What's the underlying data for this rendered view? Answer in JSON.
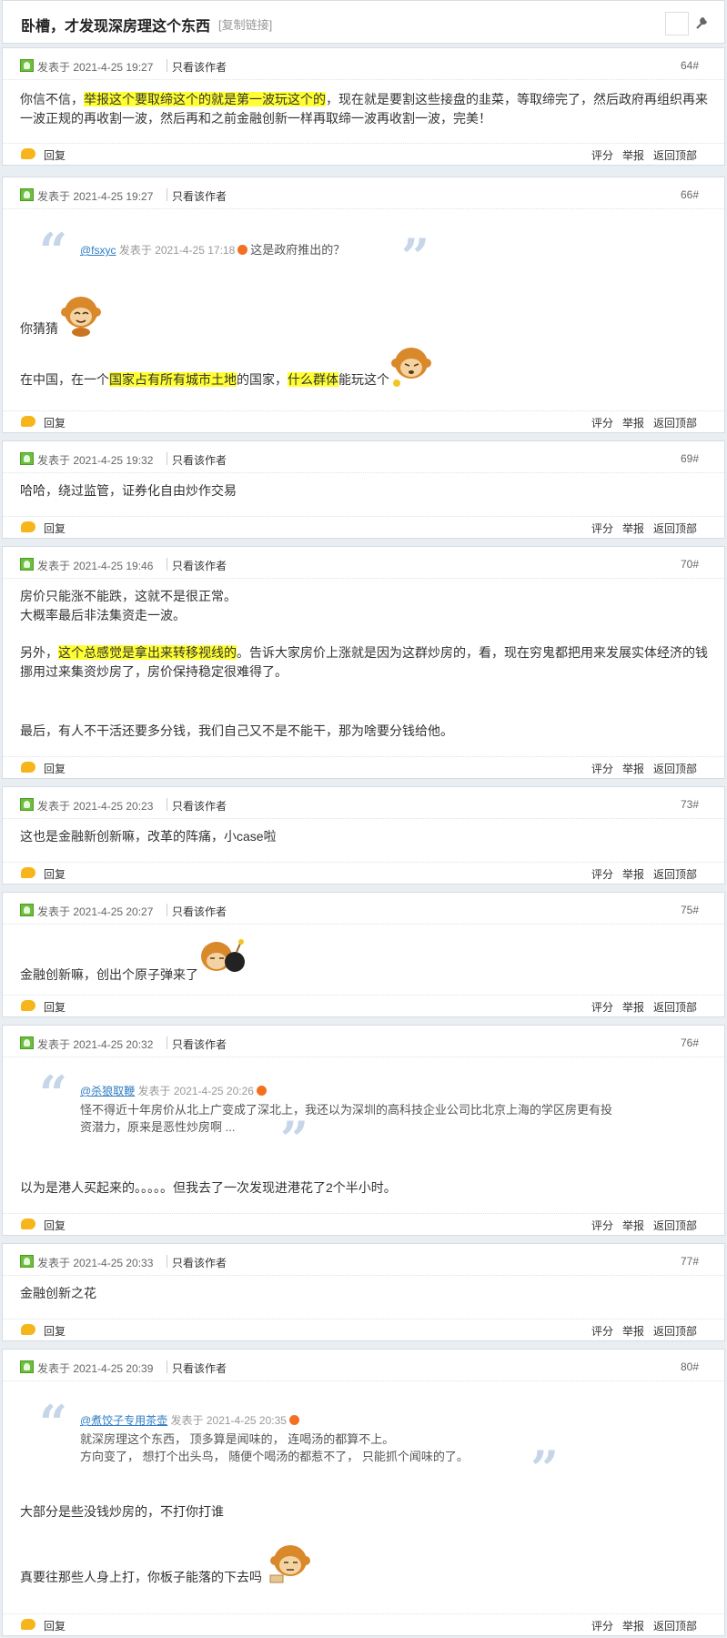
{
  "header": {
    "title": "卧槽，才发现深房理这个东西",
    "copy_link": "[复制链接]"
  },
  "labels": {
    "reply": "回复",
    "rate": "评分",
    "report": "举报",
    "top": "返回顶部",
    "only_author": "只看该作者"
  },
  "posts": [
    {
      "time": "发表于 2021-4-25 19:27",
      "floor": "64#",
      "body": {
        "a": "你信不信，",
        "hl1": "举报这个要取缔这个的就是第一波玩这个的",
        "b": "，现在就是要割这些接盘的韭菜，等取缔完了，然后政府再组织再来",
        "c": "一波正规的再收割一波，然后再和之前金融创新一样再取缔一波再收割一波，完美！"
      }
    },
    {
      "time": "发表于 2021-4-25 19:27",
      "floor": "66#",
      "quote": {
        "author": "@fsxyc",
        "time": "发表于 2021-4-25 17:18",
        "text": "这是政府推出的？"
      },
      "body": {
        "a": "你猜猜",
        "b": "在中国，在一个",
        "hl1": "国家占有所有城市土地",
        "c": "的国家，",
        "hl2": "什么群体",
        "d": "能玩这个"
      }
    },
    {
      "time": "发表于 2021-4-25 19:32",
      "floor": "69#",
      "body": {
        "a": "哈哈，绕过监管，证券化自由炒作交易"
      }
    },
    {
      "time": "发表于 2021-4-25 19:46",
      "floor": "70#",
      "body": {
        "a": "房价只能涨不能跌，这就不是很正常。",
        "b": "大概率最后非法集资走一波。",
        "c": "另外，",
        "hl1": "这个总感觉是拿出来转移视线的",
        "d": "。告诉大家房价上涨就是因为这群炒房的，看，现在穷鬼都把用来发展实体经济的钱",
        "e": "挪用过来集资炒房了，房价保持稳定很难得了。",
        "f": "最后，有人不干活还要多分钱，我们自己又不是不能干，那为啥要分钱给他。"
      }
    },
    {
      "time": "发表于 2021-4-25 20:23",
      "floor": "73#",
      "body": {
        "a": "这也是金融新创新嘛，改革的阵痛，小case啦"
      }
    },
    {
      "time": "发表于 2021-4-25 20:27",
      "floor": "75#",
      "body": {
        "a": "金融创新嘛，创出个原子弹来了"
      }
    },
    {
      "time": "发表于 2021-4-25 20:32",
      "floor": "76#",
      "quote": {
        "author": "@杀狼取鞭",
        "time": "发表于 2021-4-25 20:26",
        "text1": "怪不得近十年房价从北上广变成了深北上，我还以为深圳的高科技企业公司比北京上海的学区房更有投",
        "text2": "资潜力，原来是恶性炒房啊 ..."
      },
      "body": {
        "a": "以为是港人买起来的。。。。。但我去了一次发现进港花了2个半小时。"
      }
    },
    {
      "time": "发表于 2021-4-25 20:33",
      "floor": "77#",
      "body": {
        "a": "金融创新之花"
      }
    },
    {
      "time": "发表于 2021-4-25 20:39",
      "floor": "80#",
      "quote": {
        "author": "@煮饺子专用茶壶",
        "time": "发表于 2021-4-25 20:35",
        "text1": "就深房理这个东西， 顶多算是闻味的， 连喝汤的都算不上。",
        "text2": "方向变了， 想打个出头鸟， 随便个喝汤的都惹不了， 只能抓个闻味的了。"
      },
      "body": {
        "a": "大部分是些没钱炒房的，不打你打谁",
        "b": "真要往那些人身上打，你板子能落的下去吗"
      }
    }
  ],
  "colors": {
    "highlight": "#ffff33",
    "link": "#2d7cc4",
    "quote_mark": "#c6d6e8",
    "reply_icon": "#f6b61b"
  }
}
